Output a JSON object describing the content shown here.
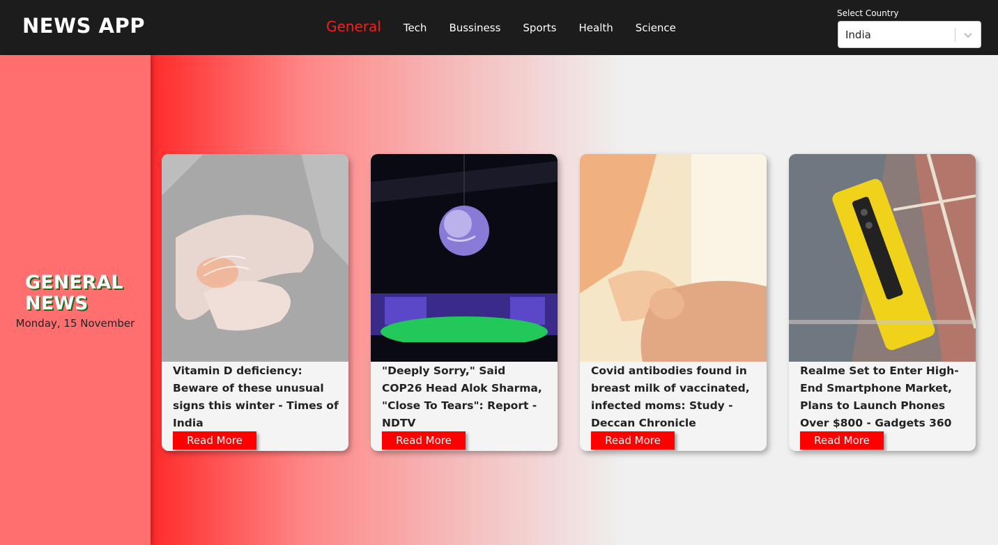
{
  "header": {
    "brand": "NEWS APP",
    "nav": [
      "General",
      "Tech",
      "Bussiness",
      "Sports",
      "Health",
      "Science"
    ],
    "active_nav": "General",
    "country_label": "Select Country",
    "country_value": "India"
  },
  "side": {
    "title_line1": "GENERAL",
    "title_line2": "NEWS",
    "date": "Monday, 15 November"
  },
  "cards": [
    {
      "title": "Vitamin D deficiency: Beware of these unusual signs this winter - Times of India",
      "button": "Read More",
      "image": "arm-pain-photo"
    },
    {
      "title": "\"Deeply Sorry,\" Said COP26 Head Alok Sharma, \"Close To Tears\": Report - NDTV",
      "button": "Read More",
      "image": "cop26-globe-photo"
    },
    {
      "title": "Covid antibodies found in breast milk of vaccinated, infected moms: Study - Deccan Chronicle",
      "button": "Read More",
      "image": "baby-hand-photo"
    },
    {
      "title": "Realme Set to Enter High-End Smartphone Market, Plans to Launch Phones Over $800 - Gadgets 360",
      "button": "Read More",
      "image": "yellow-phone-photo"
    }
  ],
  "colors": {
    "header_bg": "#1c1c1c",
    "accent": "#ff0000",
    "side_bg": "#ff6f6f"
  }
}
